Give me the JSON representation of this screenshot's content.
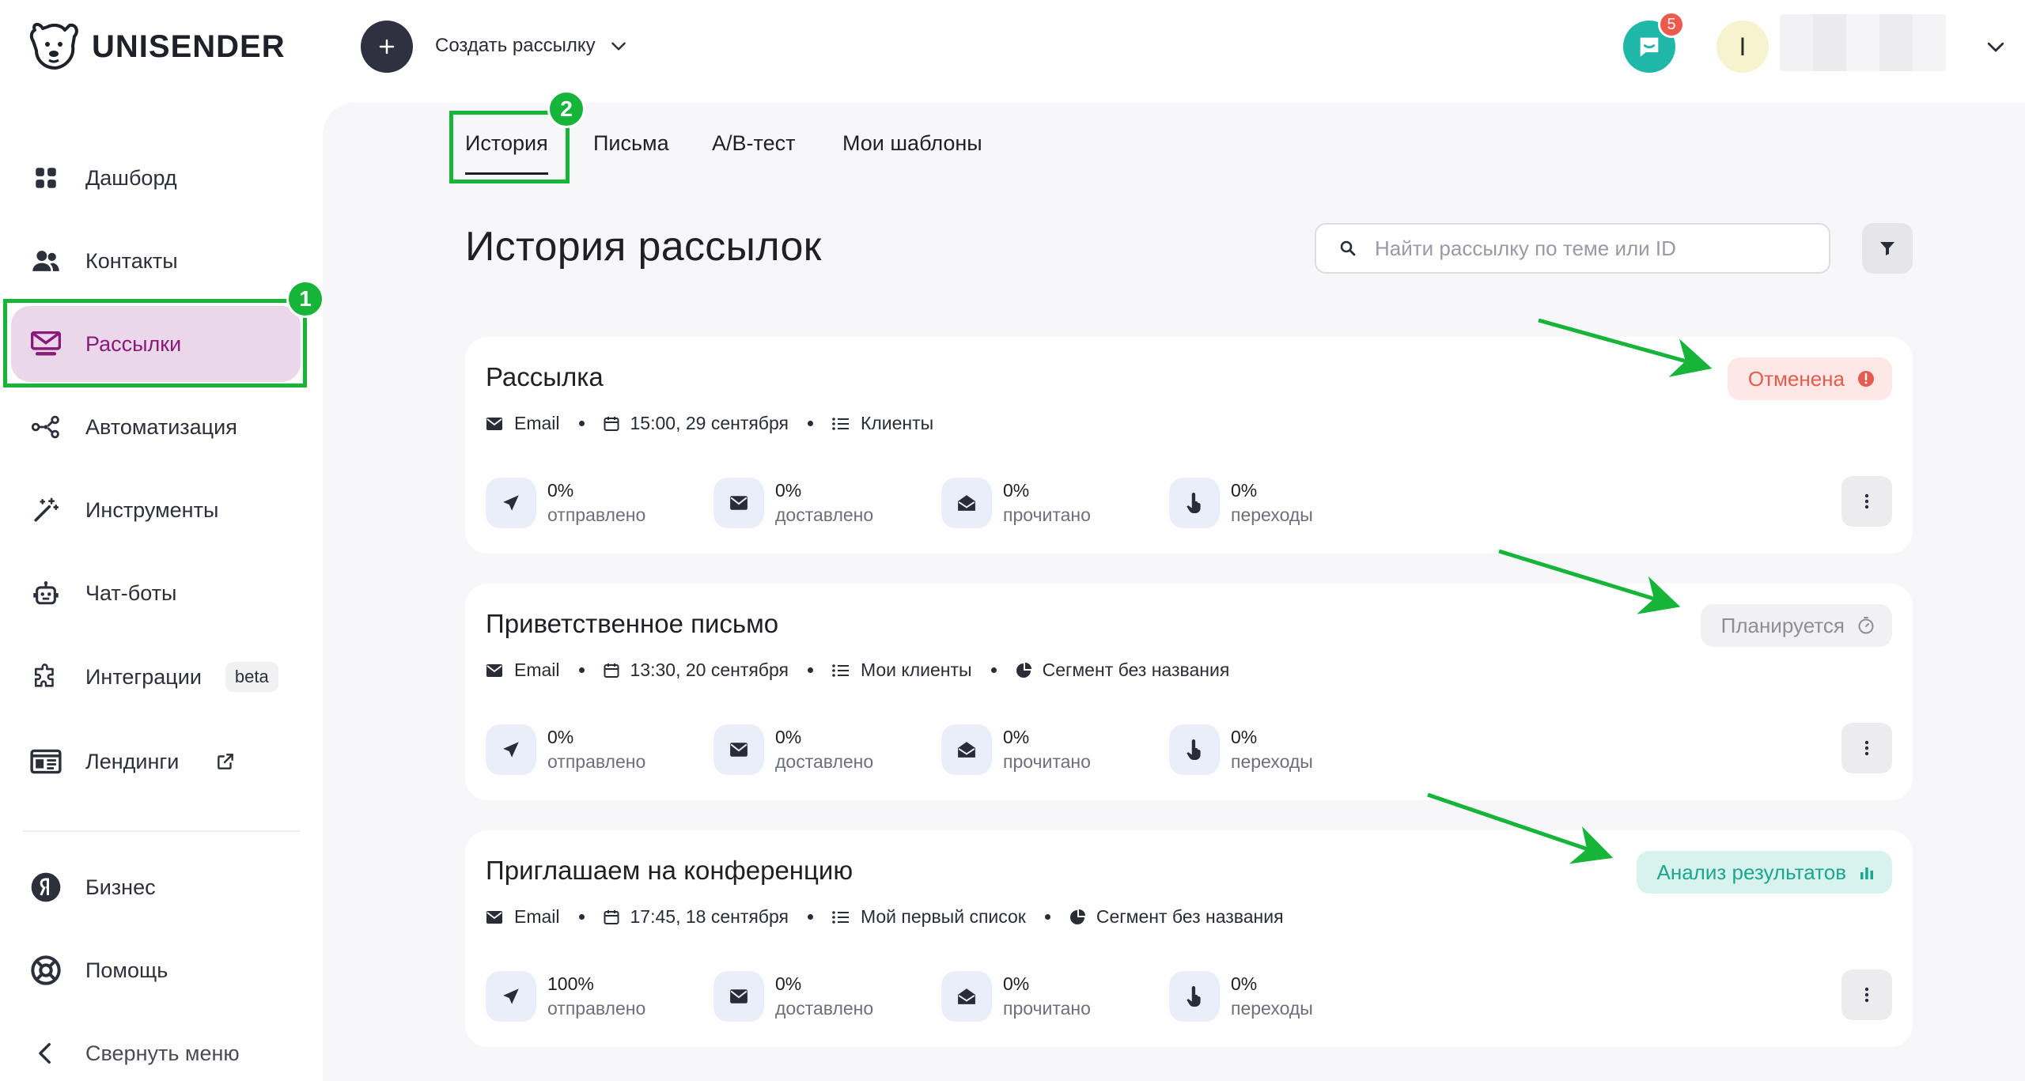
{
  "brand": {
    "name": "UNISENDER"
  },
  "header": {
    "create_label": "Создать рассылку",
    "chat_badge": "5",
    "avatar_initial": "I"
  },
  "sidebar": {
    "items": [
      {
        "label": "Дашборд",
        "icon": "dashboard-icon"
      },
      {
        "label": "Контакты",
        "icon": "contacts-icon"
      },
      {
        "label": "Рассылки",
        "icon": "mailings-icon",
        "active": true
      },
      {
        "label": "Автоматизация",
        "icon": "automation-icon"
      },
      {
        "label": "Инструменты",
        "icon": "magic-wand-icon"
      },
      {
        "label": "Чат-боты",
        "icon": "robot-icon"
      },
      {
        "label": "Интеграции",
        "icon": "puzzle-icon",
        "tag": "beta"
      },
      {
        "label": "Лендинги",
        "icon": "landing-icon"
      }
    ],
    "bottom": [
      {
        "label": "Бизнес",
        "icon": "yandex-icon"
      },
      {
        "label": "Помощь",
        "icon": "help-icon"
      },
      {
        "label": "Свернуть меню",
        "icon": "collapse-icon"
      }
    ]
  },
  "annotations": {
    "badge1": "1",
    "badge2": "2"
  },
  "tabs": [
    "История",
    "Письма",
    "A/B-тест",
    "Мои шаблоны"
  ],
  "page": {
    "title": "История рассылок",
    "search_placeholder": "Найти рассылку по теме или ID"
  },
  "cards": [
    {
      "title": "Рассылка",
      "channel": "Email",
      "date": "15:00, 29 сентября",
      "list": "Клиенты",
      "segment": null,
      "status": "Отменена",
      "status_kind": "cancel",
      "stats": [
        {
          "value": "0%",
          "label": "отправлено"
        },
        {
          "value": "0%",
          "label": "доставлено"
        },
        {
          "value": "0%",
          "label": "прочитано"
        },
        {
          "value": "0%",
          "label": "переходы"
        }
      ]
    },
    {
      "title": "Приветственное письмо",
      "channel": "Email",
      "date": "13:30, 20 сентября",
      "list": "Мои клиенты",
      "segment": "Сегмент без названия",
      "status": "Планируется",
      "status_kind": "plan",
      "stats": [
        {
          "value": "0%",
          "label": "отправлено"
        },
        {
          "value": "0%",
          "label": "доставлено"
        },
        {
          "value": "0%",
          "label": "прочитано"
        },
        {
          "value": "0%",
          "label": "переходы"
        }
      ]
    },
    {
      "title": "Приглашаем на конференцию",
      "channel": "Email",
      "date": "17:45, 18 сентября",
      "list": "Мой первый список",
      "segment": "Сегмент без названия",
      "status": "Анализ результатов",
      "status_kind": "analysis",
      "stats": [
        {
          "value": "100%",
          "label": "отправлено"
        },
        {
          "value": "0%",
          "label": "доставлено"
        },
        {
          "value": "0%",
          "label": "прочитано"
        },
        {
          "value": "0%",
          "label": "переходы"
        }
      ]
    }
  ],
  "colors": {
    "accent": "#8a1a7a",
    "active_bg": "#ead7e9",
    "annotation_green": "#16b53a",
    "teal": "#1fb7a8",
    "cancel": "#e65b4f",
    "analysis": "#1aa68f"
  }
}
